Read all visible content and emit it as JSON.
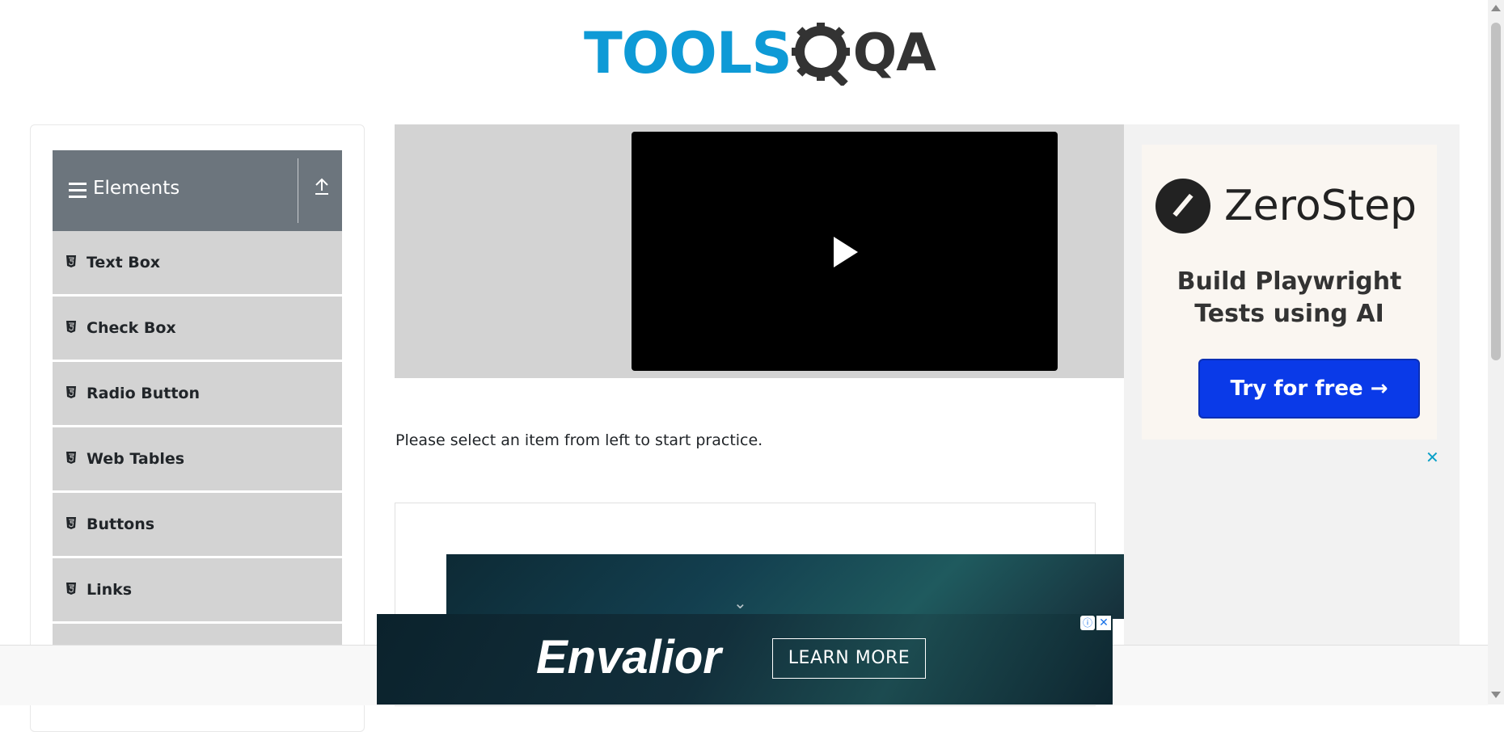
{
  "logo": {
    "part1": "TOOLS",
    "part2": "QA"
  },
  "sidebar": {
    "group_title": "Elements",
    "items": [
      {
        "label": "Text Box"
      },
      {
        "label": "Check Box"
      },
      {
        "label": "Radio Button"
      },
      {
        "label": "Web Tables"
      },
      {
        "label": "Buttons"
      },
      {
        "label": "Links"
      },
      {
        "label": ""
      }
    ]
  },
  "main": {
    "message": "Please select an item from left to start practice."
  },
  "ad_right": {
    "brand": "ZeroStep",
    "headline_line1": "Build Playwright",
    "headline_line2": "Tests using AI",
    "cta": "Try for free →",
    "close": "✕"
  },
  "ad_bottom": {
    "brand": "Envalior",
    "cta": "LEARN MORE",
    "info": "ⓘ",
    "close": "✕"
  },
  "colors": {
    "brand_blue": "#0e9ad6",
    "sidebar_header": "#6c757d",
    "menu_item_bg": "#d3d3d3",
    "zerostep_button": "#0a3ae8"
  }
}
